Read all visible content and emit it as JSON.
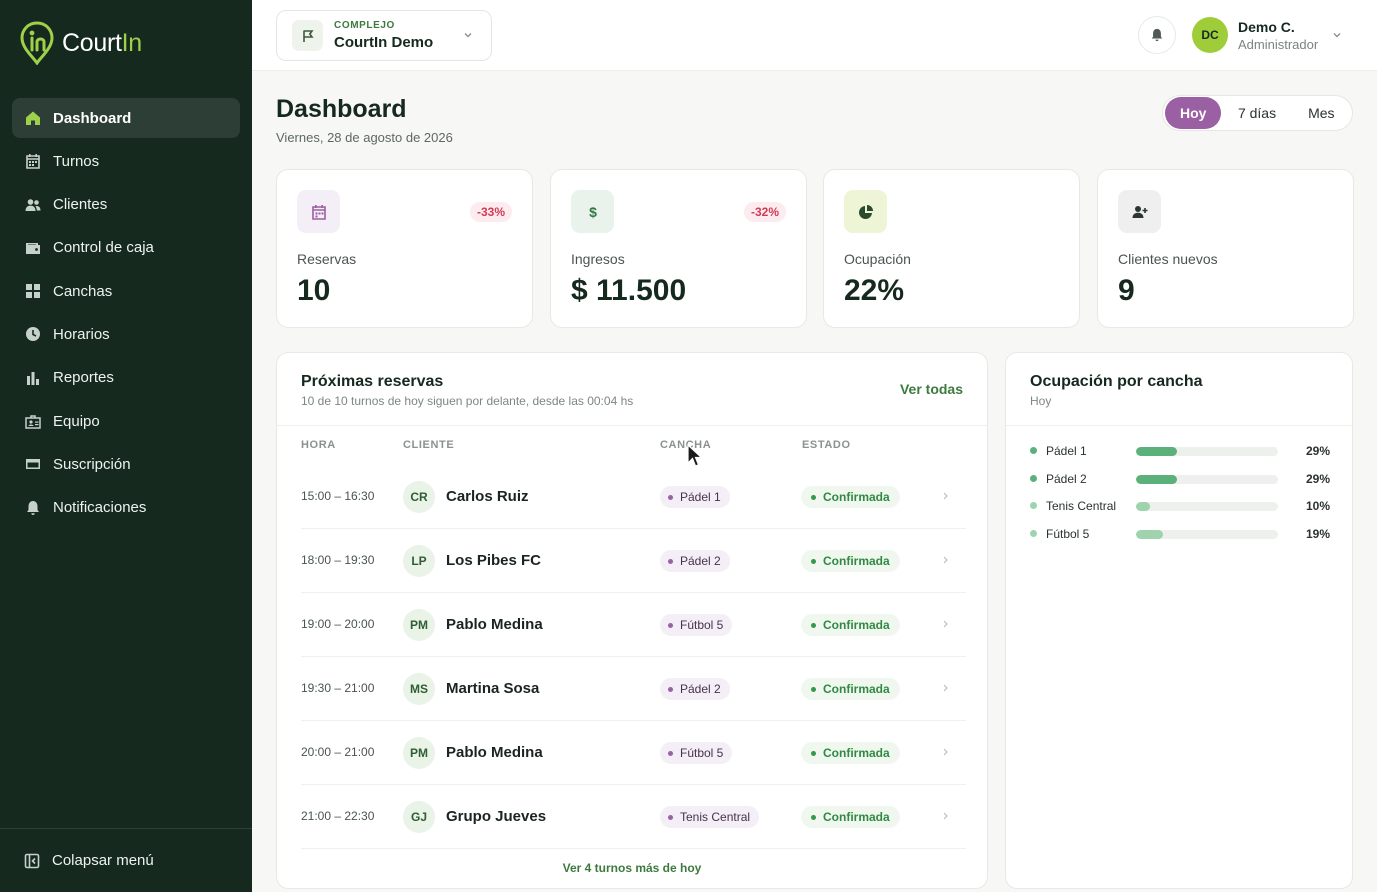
{
  "brand": {
    "name_prefix": "Court",
    "name_suffix": "In"
  },
  "sidebar": {
    "items": [
      {
        "label": "Dashboard",
        "icon": "home-icon",
        "active": true
      },
      {
        "label": "Turnos",
        "icon": "calendar-icon"
      },
      {
        "label": "Clientes",
        "icon": "users-icon"
      },
      {
        "label": "Control de caja",
        "icon": "wallet-icon"
      },
      {
        "label": "Canchas",
        "icon": "grid-icon"
      },
      {
        "label": "Horarios",
        "icon": "clock-icon"
      },
      {
        "label": "Reportes",
        "icon": "bar-chart-icon"
      },
      {
        "label": "Equipo",
        "icon": "team-icon"
      },
      {
        "label": "Suscripción",
        "icon": "credit-card-icon"
      },
      {
        "label": "Notificaciones",
        "icon": "bell-icon"
      }
    ],
    "collapse_label": "Colapsar menú"
  },
  "header": {
    "complex_caption": "COMPLEJO",
    "complex_name": "CourtIn Demo",
    "user_initials": "DC",
    "user_name": "Demo C.",
    "user_role": "Administrador"
  },
  "page": {
    "title": "Dashboard",
    "date": "Viernes, 28 de agosto de 2026",
    "ranges": [
      "Hoy",
      "7 días",
      "Mes"
    ],
    "selected_range": "Hoy"
  },
  "stats": [
    {
      "label": "Reservas",
      "value": "10",
      "badge": "-33%",
      "icon": "calendar-icon"
    },
    {
      "label": "Ingresos",
      "value": "$ 11.500",
      "badge": "-32%",
      "icon": "dollar-icon"
    },
    {
      "label": "Ocupación",
      "value": "22%",
      "badge": "",
      "icon": "pie-chart-icon"
    },
    {
      "label": "Clientes nuevos",
      "value": "9",
      "badge": "",
      "icon": "user-plus-icon"
    }
  ],
  "reservations": {
    "title": "Próximas reservas",
    "subtitle": "10 de 10 turnos de hoy siguen por delante, desde las 00:04 hs",
    "view_all": "Ver todas",
    "columns": [
      "HORA",
      "CLIENTE",
      "CANCHA",
      "ESTADO"
    ],
    "rows": [
      {
        "hora": "15:00 – 16:30",
        "initials": "CR",
        "cliente": "Carlos Ruiz",
        "cancha": "Pádel 1",
        "estado": "Confirmada"
      },
      {
        "hora": "18:00 – 19:30",
        "initials": "LP",
        "cliente": "Los Pibes FC",
        "cancha": "Pádel 2",
        "estado": "Confirmada"
      },
      {
        "hora": "19:00 – 20:00",
        "initials": "PM",
        "cliente": "Pablo Medina",
        "cancha": "Fútbol 5",
        "estado": "Confirmada"
      },
      {
        "hora": "19:30 – 21:00",
        "initials": "MS",
        "cliente": "Martina Sosa",
        "cancha": "Pádel 2",
        "estado": "Confirmada"
      },
      {
        "hora": "20:00 – 21:00",
        "initials": "PM",
        "cliente": "Pablo Medina",
        "cancha": "Fútbol 5",
        "estado": "Confirmada"
      },
      {
        "hora": "21:00 – 22:30",
        "initials": "GJ",
        "cliente": "Grupo Jueves",
        "cancha": "Tenis Central",
        "estado": "Confirmada"
      }
    ],
    "more": "Ver 4 turnos más de hoy"
  },
  "occupancy": {
    "title": "Ocupación por cancha",
    "subtitle": "Hoy",
    "rows": [
      {
        "name": "Pádel 1",
        "pct_label": "29%",
        "value": 29,
        "color": "#5cb07a"
      },
      {
        "name": "Pádel 2",
        "pct_label": "29%",
        "value": 29,
        "color": "#5cb07a"
      },
      {
        "name": "Tenis Central",
        "pct_label": "10%",
        "value": 10,
        "color": "#9ed3ad"
      },
      {
        "name": "Fútbol 5",
        "pct_label": "19%",
        "value": 19,
        "color": "#9ed3ad"
      }
    ]
  },
  "colors": {
    "sidebar_bg": "#15291f",
    "accent_green": "#9fd04a",
    "accent_purple": "#9b5fa3",
    "negative": "#d23a55"
  }
}
